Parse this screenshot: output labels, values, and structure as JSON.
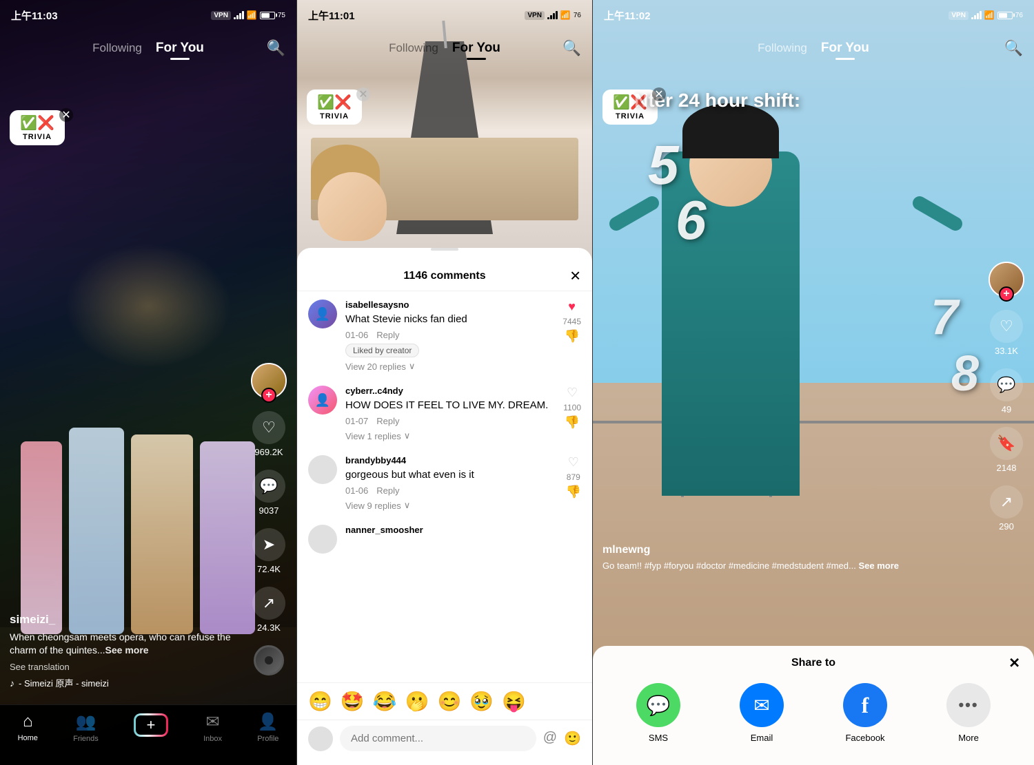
{
  "screen1": {
    "status": {
      "time": "上午11:03",
      "vpn": "VPN",
      "battery": "75"
    },
    "nav": {
      "following": "Following",
      "foryou": "For You"
    },
    "trivia": {
      "label": "TRIVIA",
      "icons": "✓✕"
    },
    "video": {
      "username": "simeizi_",
      "caption": "When cheongsam meets opera, who can refuse the charm of the quintes...",
      "see_more": "See more",
      "translation": "See translation",
      "music_note": "♪",
      "music_text": "- Simeizi    原声 - simeizi"
    },
    "actions": {
      "like_count": "969.2K",
      "comment_count": "9037",
      "share_count": "72.4K",
      "bookmark_count": "24.3K"
    }
  },
  "screen2": {
    "status": {
      "time": "上午11:01",
      "vpn": "VPN",
      "battery": "76"
    },
    "nav": {
      "following": "Following",
      "foryou": "For You"
    },
    "trivia": {
      "label": "TRIVIA"
    },
    "comments": {
      "title": "1146 comments",
      "items": [
        {
          "username": "isabellesaysno",
          "text": "What Stevie nicks fan died",
          "date": "01-06",
          "reply": "Reply",
          "likes": "7445",
          "liked_by_creator": "Liked by creator",
          "view_replies": "View 20 replies"
        },
        {
          "username": "cyberr..c4ndy",
          "text": "HOW DOES IT FEEL TO LIVE MY. DREAM.",
          "date": "01-07",
          "reply": "Reply",
          "likes": "1100",
          "view_replies": "View 1 replies"
        },
        {
          "username": "brandybby444",
          "text": "gorgeous but what even is it",
          "date": "01-06",
          "reply": "Reply",
          "likes": "879",
          "view_replies": "View 9 replies"
        },
        {
          "username": "nanner_smoosher",
          "text": "",
          "date": "",
          "reply": "",
          "likes": ""
        }
      ]
    },
    "emojis": [
      "😁",
      "🤩",
      "😂",
      "🫢",
      "😊",
      "🥹",
      "😝"
    ],
    "comment_placeholder": "Add comment..."
  },
  "screen3": {
    "status": {
      "time": "上午11:02",
      "vpn": "VPN",
      "battery": "76"
    },
    "nav": {
      "following": "Following",
      "foryou": "For You"
    },
    "trivia": {
      "label": "TRIVIA"
    },
    "numbers": [
      "5",
      "6"
    ],
    "numbers2": [
      "7",
      "8"
    ],
    "video_text": "ter 24 hour shift:",
    "video": {
      "username": "mlnewng",
      "caption": "Go team!! #fyp #foryou #doctor #medicine #medstudent #med...",
      "see_more": "See more"
    },
    "actions": {
      "like_count": "33.1K",
      "comment_count": "49",
      "share_count": "2148",
      "bookmark_count": "290"
    },
    "share": {
      "title": "Share to",
      "items": [
        {
          "icon": "💬",
          "label": "SMS",
          "color": "sms"
        },
        {
          "icon": "✉",
          "label": "Email",
          "color": "email"
        },
        {
          "icon": "f",
          "label": "Facebook",
          "color": "fb"
        },
        {
          "icon": "•••",
          "label": "More",
          "color": "more"
        }
      ]
    }
  },
  "bottom_nav": {
    "items": [
      {
        "icon": "⌂",
        "label": "Home",
        "active": true
      },
      {
        "icon": "👥",
        "label": "Friends",
        "active": false
      },
      {
        "icon": "+",
        "label": "",
        "active": false
      },
      {
        "icon": "✉",
        "label": "Inbox",
        "active": false
      },
      {
        "icon": "👤",
        "label": "Profile",
        "active": false
      }
    ]
  }
}
